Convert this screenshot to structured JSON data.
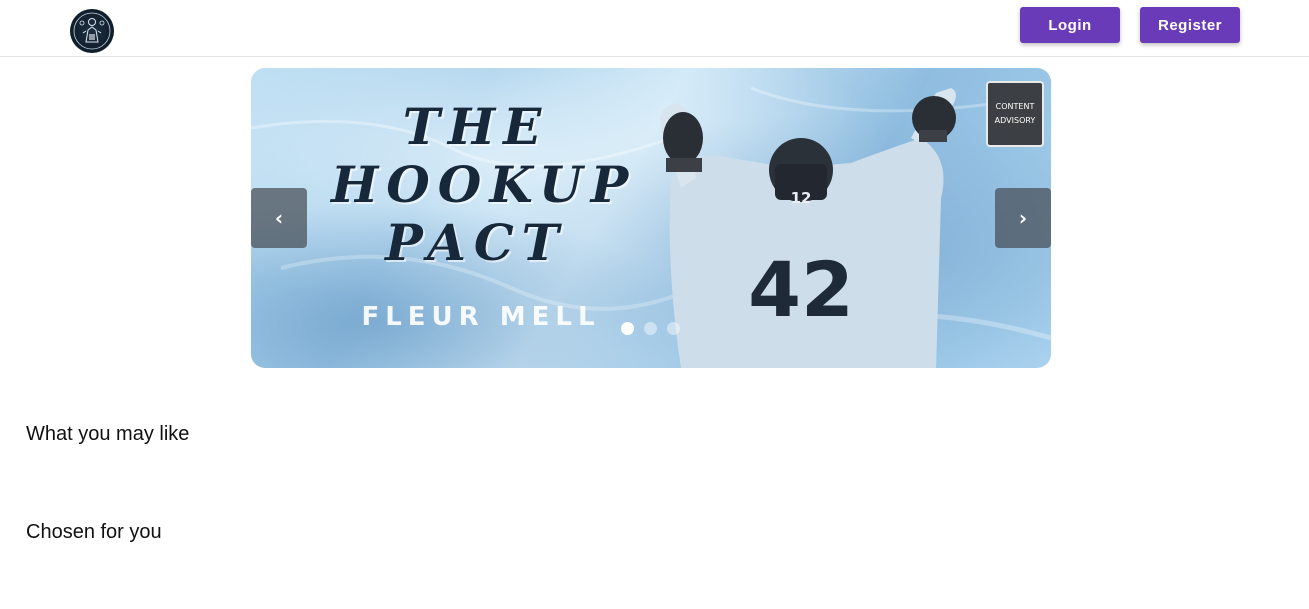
{
  "header": {
    "logo_icon": "app-logo-icon",
    "login_label": "Login",
    "register_label": "Register",
    "accent_color": "#6a3bb8"
  },
  "carousel": {
    "slides": [
      {
        "title": "THE\nHOOKUP\nPACT",
        "author": "FLEUR MELL",
        "jersey_number": "42",
        "helmet_number": "12",
        "advisory_line1": "CONTENT",
        "advisory_line2": "ADVISORY"
      }
    ],
    "prev_icon": "chevron-left-icon",
    "next_icon": "chevron-right-icon",
    "prev_glyph": "‹",
    "next_glyph": "›",
    "active_index": 0,
    "total_slides": 3
  },
  "sections": [
    {
      "heading": "What you may like"
    },
    {
      "heading": "Chosen for you"
    }
  ]
}
